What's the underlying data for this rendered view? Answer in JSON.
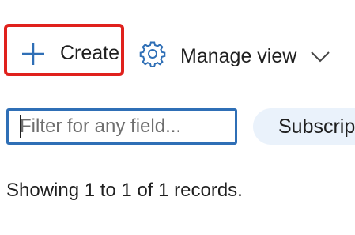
{
  "toolbar": {
    "create_label": "Create",
    "create_icon": "plus-icon",
    "manage_view_label": "Manage view",
    "manage_view_icon": "gear-icon",
    "manage_view_chevron": "chevron-down-icon"
  },
  "filter": {
    "placeholder": "Filter for any field...",
    "value": ""
  },
  "pills": {
    "subscription_label": "Subscrip"
  },
  "records": {
    "summary": "Showing 1 to 1 of 1 records."
  },
  "colors": {
    "accent": "#2f6fb6",
    "highlight_border": "#e0211d",
    "pill_background": "#eaf2fb"
  }
}
